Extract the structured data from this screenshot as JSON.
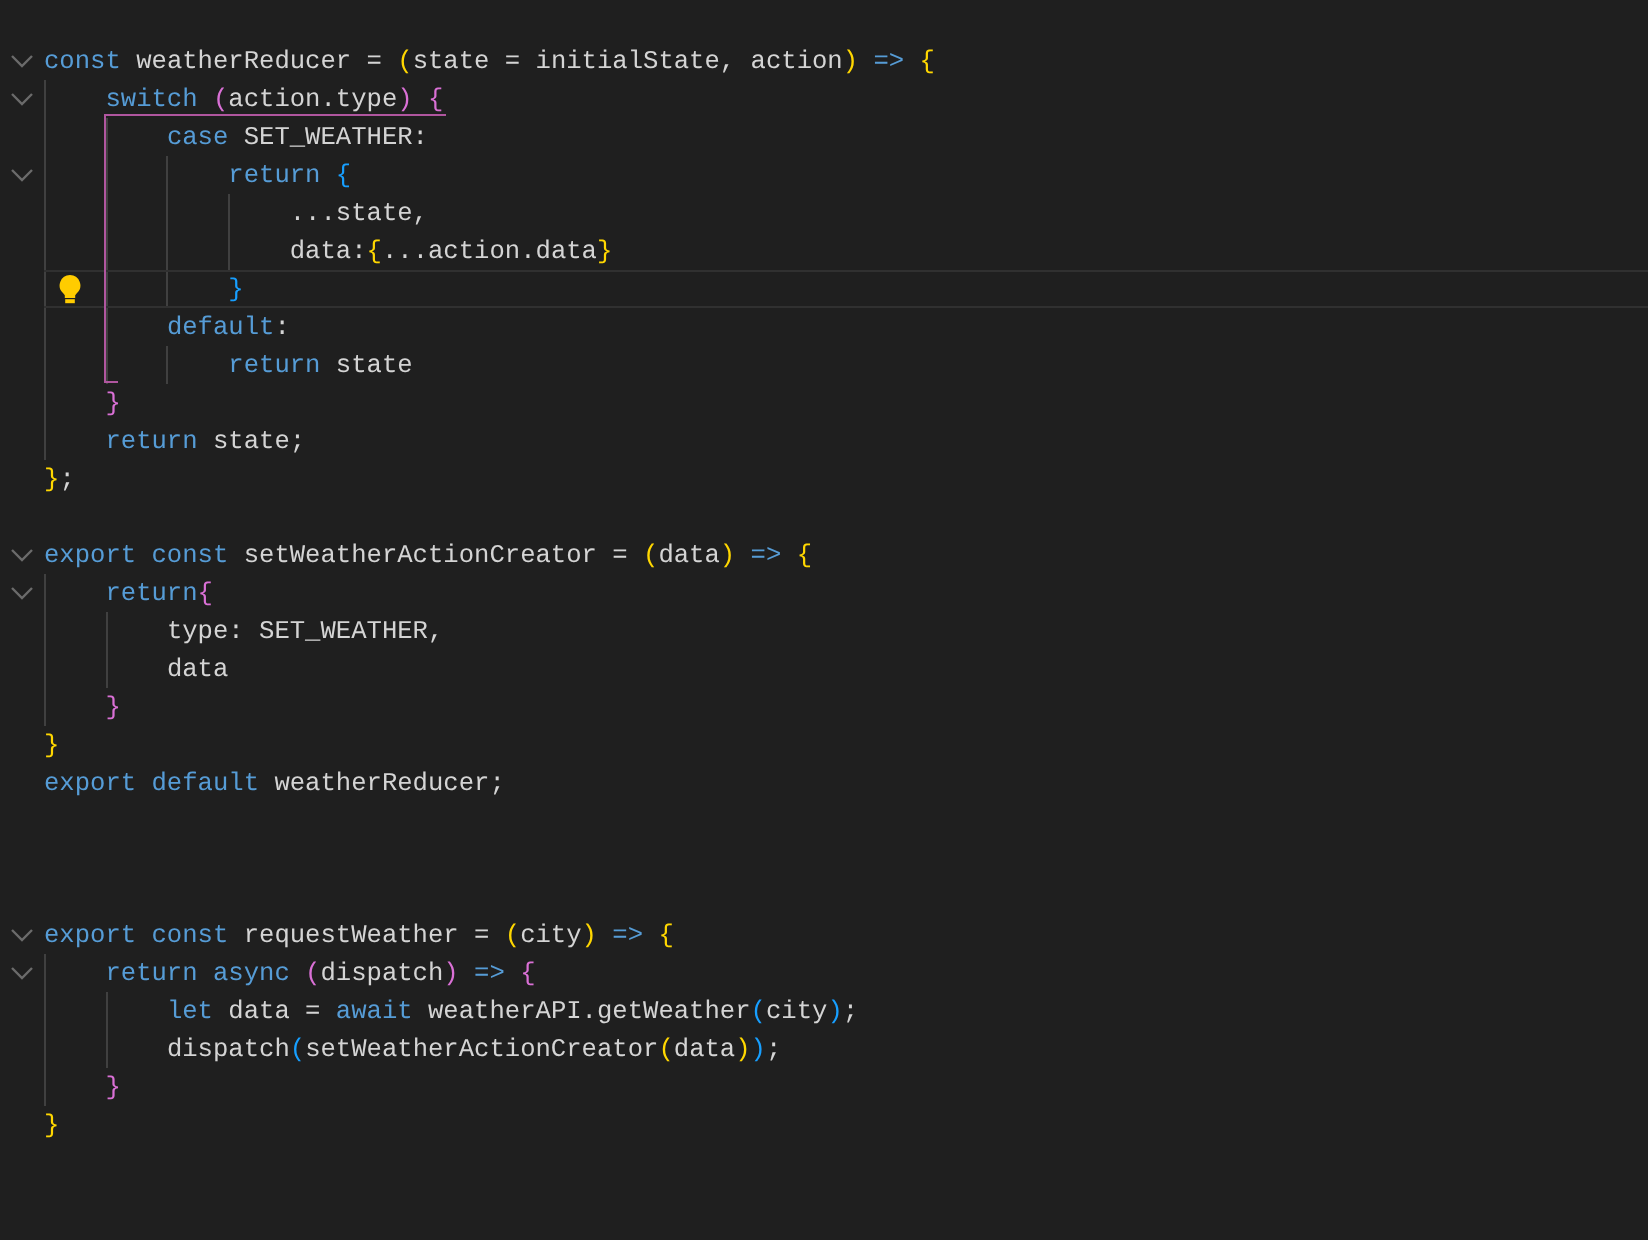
{
  "editor": {
    "lines": [
      {
        "kind": "code",
        "foldable": true,
        "current": false,
        "lightbulb": false,
        "tokens": [
          {
            "text": "const",
            "color": "#569cd6"
          },
          {
            "text": " weatherReducer = ",
            "color": "#d4d4d4"
          },
          {
            "text": "(",
            "color": "#ffd700"
          },
          {
            "text": "state = initialState, action",
            "color": "#d4d4d4"
          },
          {
            "text": ")",
            "color": "#ffd700"
          },
          {
            "text": " =>",
            "color": "#569cd6"
          },
          {
            "text": " {",
            "color": "#ffd700"
          }
        ]
      },
      {
        "kind": "code",
        "foldable": true,
        "current": false,
        "lightbulb": false,
        "tokens": [
          {
            "text": "    switch",
            "color": "#569cd6"
          },
          {
            "text": " (",
            "color": "#da70d6"
          },
          {
            "text": "action.type",
            "color": "#d4d4d4"
          },
          {
            "text": ")",
            "color": "#da70d6"
          },
          {
            "text": " {",
            "color": "#da70d6"
          }
        ]
      },
      {
        "kind": "code",
        "foldable": false,
        "current": false,
        "lightbulb": false,
        "tokens": [
          {
            "text": "        case",
            "color": "#569cd6"
          },
          {
            "text": " SET_WEATHER:",
            "color": "#d4d4d4"
          }
        ]
      },
      {
        "kind": "code",
        "foldable": true,
        "current": false,
        "lightbulb": false,
        "tokens": [
          {
            "text": "            return",
            "color": "#569cd6"
          },
          {
            "text": " {",
            "color": "#179fff"
          }
        ]
      },
      {
        "kind": "code",
        "foldable": false,
        "current": false,
        "lightbulb": false,
        "tokens": [
          {
            "text": "                ...state,",
            "color": "#d4d4d4"
          }
        ]
      },
      {
        "kind": "code",
        "foldable": false,
        "current": false,
        "lightbulb": false,
        "tokens": [
          {
            "text": "                data:",
            "color": "#d4d4d4"
          },
          {
            "text": "{",
            "color": "#ffd700"
          },
          {
            "text": "...action.data",
            "color": "#d4d4d4"
          },
          {
            "text": "}",
            "color": "#ffd700"
          }
        ]
      },
      {
        "kind": "code",
        "foldable": false,
        "current": true,
        "lightbulb": true,
        "tokens": [
          {
            "text": "            }",
            "color": "#179fff"
          }
        ]
      },
      {
        "kind": "code",
        "foldable": false,
        "current": false,
        "lightbulb": false,
        "tokens": [
          {
            "text": "        default",
            "color": "#569cd6"
          },
          {
            "text": ":",
            "color": "#d4d4d4"
          }
        ]
      },
      {
        "kind": "code",
        "foldable": false,
        "current": false,
        "lightbulb": false,
        "tokens": [
          {
            "text": "            return",
            "color": "#569cd6"
          },
          {
            "text": " state",
            "color": "#d4d4d4"
          }
        ]
      },
      {
        "kind": "code",
        "foldable": false,
        "current": false,
        "lightbulb": false,
        "tokens": [
          {
            "text": "    }",
            "color": "#da70d6"
          }
        ]
      },
      {
        "kind": "code",
        "foldable": false,
        "current": false,
        "lightbulb": false,
        "tokens": [
          {
            "text": "    return",
            "color": "#569cd6"
          },
          {
            "text": " state;",
            "color": "#d4d4d4"
          }
        ]
      },
      {
        "kind": "code",
        "foldable": false,
        "current": false,
        "lightbulb": false,
        "tokens": [
          {
            "text": "}",
            "color": "#ffd700"
          },
          {
            "text": ";",
            "color": "#d4d4d4"
          }
        ]
      },
      {
        "kind": "blank"
      },
      {
        "kind": "code",
        "foldable": true,
        "current": false,
        "lightbulb": false,
        "tokens": [
          {
            "text": "export",
            "color": "#569cd6"
          },
          {
            "text": " const",
            "color": "#569cd6"
          },
          {
            "text": " setWeatherActionCreator = ",
            "color": "#d4d4d4"
          },
          {
            "text": "(",
            "color": "#ffd700"
          },
          {
            "text": "data",
            "color": "#d4d4d4"
          },
          {
            "text": ")",
            "color": "#ffd700"
          },
          {
            "text": " =>",
            "color": "#569cd6"
          },
          {
            "text": " {",
            "color": "#ffd700"
          }
        ]
      },
      {
        "kind": "code",
        "foldable": true,
        "current": false,
        "lightbulb": false,
        "tokens": [
          {
            "text": "    return",
            "color": "#569cd6"
          },
          {
            "text": "{",
            "color": "#da70d6"
          }
        ]
      },
      {
        "kind": "code",
        "foldable": false,
        "current": false,
        "lightbulb": false,
        "tokens": [
          {
            "text": "        type: SET_WEATHER,",
            "color": "#d4d4d4"
          }
        ]
      },
      {
        "kind": "code",
        "foldable": false,
        "current": false,
        "lightbulb": false,
        "tokens": [
          {
            "text": "        data",
            "color": "#d4d4d4"
          }
        ]
      },
      {
        "kind": "code",
        "foldable": false,
        "current": false,
        "lightbulb": false,
        "tokens": [
          {
            "text": "    }",
            "color": "#da70d6"
          }
        ]
      },
      {
        "kind": "code",
        "foldable": false,
        "current": false,
        "lightbulb": false,
        "tokens": [
          {
            "text": "}",
            "color": "#ffd700"
          }
        ]
      },
      {
        "kind": "code",
        "foldable": false,
        "current": false,
        "lightbulb": false,
        "tokens": [
          {
            "text": "export",
            "color": "#569cd6"
          },
          {
            "text": " default",
            "color": "#569cd6"
          },
          {
            "text": " weatherReducer;",
            "color": "#d4d4d4"
          }
        ]
      },
      {
        "kind": "blank"
      },
      {
        "kind": "blank"
      },
      {
        "kind": "blank"
      },
      {
        "kind": "code",
        "foldable": true,
        "current": false,
        "lightbulb": false,
        "tokens": [
          {
            "text": "export",
            "color": "#569cd6"
          },
          {
            "text": " const",
            "color": "#569cd6"
          },
          {
            "text": " requestWeather = ",
            "color": "#d4d4d4"
          },
          {
            "text": "(",
            "color": "#ffd700"
          },
          {
            "text": "city",
            "color": "#d4d4d4"
          },
          {
            "text": ")",
            "color": "#ffd700"
          },
          {
            "text": " =>",
            "color": "#569cd6"
          },
          {
            "text": " {",
            "color": "#ffd700"
          }
        ]
      },
      {
        "kind": "code",
        "foldable": true,
        "current": false,
        "lightbulb": false,
        "tokens": [
          {
            "text": "    return",
            "color": "#569cd6"
          },
          {
            "text": " async",
            "color": "#569cd6"
          },
          {
            "text": " (",
            "color": "#da70d6"
          },
          {
            "text": "dispatch",
            "color": "#d4d4d4"
          },
          {
            "text": ")",
            "color": "#da70d6"
          },
          {
            "text": " =>",
            "color": "#569cd6"
          },
          {
            "text": " {",
            "color": "#da70d6"
          }
        ]
      },
      {
        "kind": "code",
        "foldable": false,
        "current": false,
        "lightbulb": false,
        "tokens": [
          {
            "text": "        let",
            "color": "#569cd6"
          },
          {
            "text": " data = ",
            "color": "#d4d4d4"
          },
          {
            "text": "await",
            "color": "#569cd6"
          },
          {
            "text": " weatherAPI.getWeather",
            "color": "#d4d4d4"
          },
          {
            "text": "(",
            "color": "#179fff"
          },
          {
            "text": "city",
            "color": "#d4d4d4"
          },
          {
            "text": ")",
            "color": "#179fff"
          },
          {
            "text": ";",
            "color": "#d4d4d4"
          }
        ]
      },
      {
        "kind": "code",
        "foldable": false,
        "current": false,
        "lightbulb": false,
        "tokens": [
          {
            "text": "        dispatch",
            "color": "#d4d4d4"
          },
          {
            "text": "(",
            "color": "#179fff"
          },
          {
            "text": "setWeatherActionCreator",
            "color": "#d4d4d4"
          },
          {
            "text": "(",
            "color": "#ffd700"
          },
          {
            "text": "data",
            "color": "#d4d4d4"
          },
          {
            "text": ")",
            "color": "#ffd700"
          },
          {
            "text": ")",
            "color": "#179fff"
          },
          {
            "text": ";",
            "color": "#d4d4d4"
          }
        ]
      },
      {
        "kind": "code",
        "foldable": false,
        "current": false,
        "lightbulb": false,
        "tokens": [
          {
            "text": "    }",
            "color": "#da70d6"
          }
        ]
      },
      {
        "kind": "code",
        "foldable": false,
        "current": false,
        "lightbulb": false,
        "tokens": [
          {
            "text": "}",
            "color": "#ffd700"
          }
        ]
      }
    ]
  }
}
